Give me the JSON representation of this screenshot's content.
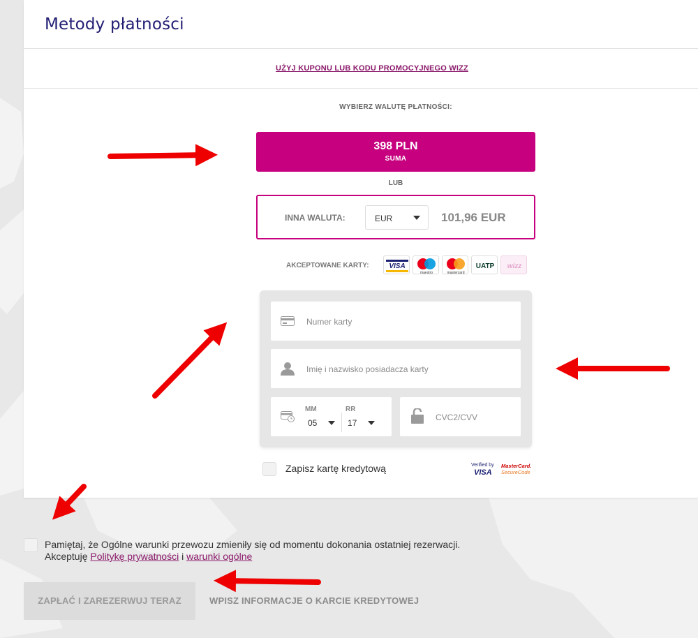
{
  "header": {
    "title": "Metody płatności"
  },
  "coupon": {
    "link_label": "UŻYJ KUPONU LUB KODU PROMOCYJNEGO WIZZ"
  },
  "currency": {
    "section_title": "WYBIERZ WALUTĘ PŁATNOŚCI:",
    "total_amount": "398 PLN",
    "total_label": "SUMA",
    "or_label": "LUB",
    "other_label": "INNA WALUTA:",
    "other_selected": "EUR",
    "other_amount": "101,96 EUR"
  },
  "cards": {
    "accepted_label": "AKCEPTOWANE KARTY:",
    "logos": [
      "VISA",
      "maestro",
      "mastercard",
      "UATP",
      "wizz"
    ]
  },
  "form": {
    "card_number_placeholder": "Numer karty",
    "holder_placeholder": "Imię i nazwisko posiadacza karty",
    "month_label": "MM",
    "month_value": "05",
    "year_label": "RR",
    "year_value": "17",
    "cvc_placeholder": "CVC2/CVV",
    "save_card_label": "Zapisz kartę kredytową",
    "verified_by": "Verified by",
    "verified_visa": "VISA",
    "mc_secure_1": "MasterCard.",
    "mc_secure_2": "SecureCode"
  },
  "terms": {
    "line1": "Pamiętaj, że Ogólne warunki przewozu zmieniły się od momentu dokonania ostatniej rezerwacji.",
    "accept_prefix": "Akceptuję ",
    "privacy_link": "Politykę prywatności",
    "conjunction": " i ",
    "terms_link": "warunki ogólne"
  },
  "actions": {
    "pay_button": "ZAPŁAĆ I ZAREZERWUJ TERAZ",
    "pay_hint": "WPISZ INFORMACJE O KARCIE KREDYTOWEJ"
  },
  "colors": {
    "brand_magenta": "#c6007e",
    "title_navy": "#221e73",
    "annotation_red": "#ee0000"
  }
}
